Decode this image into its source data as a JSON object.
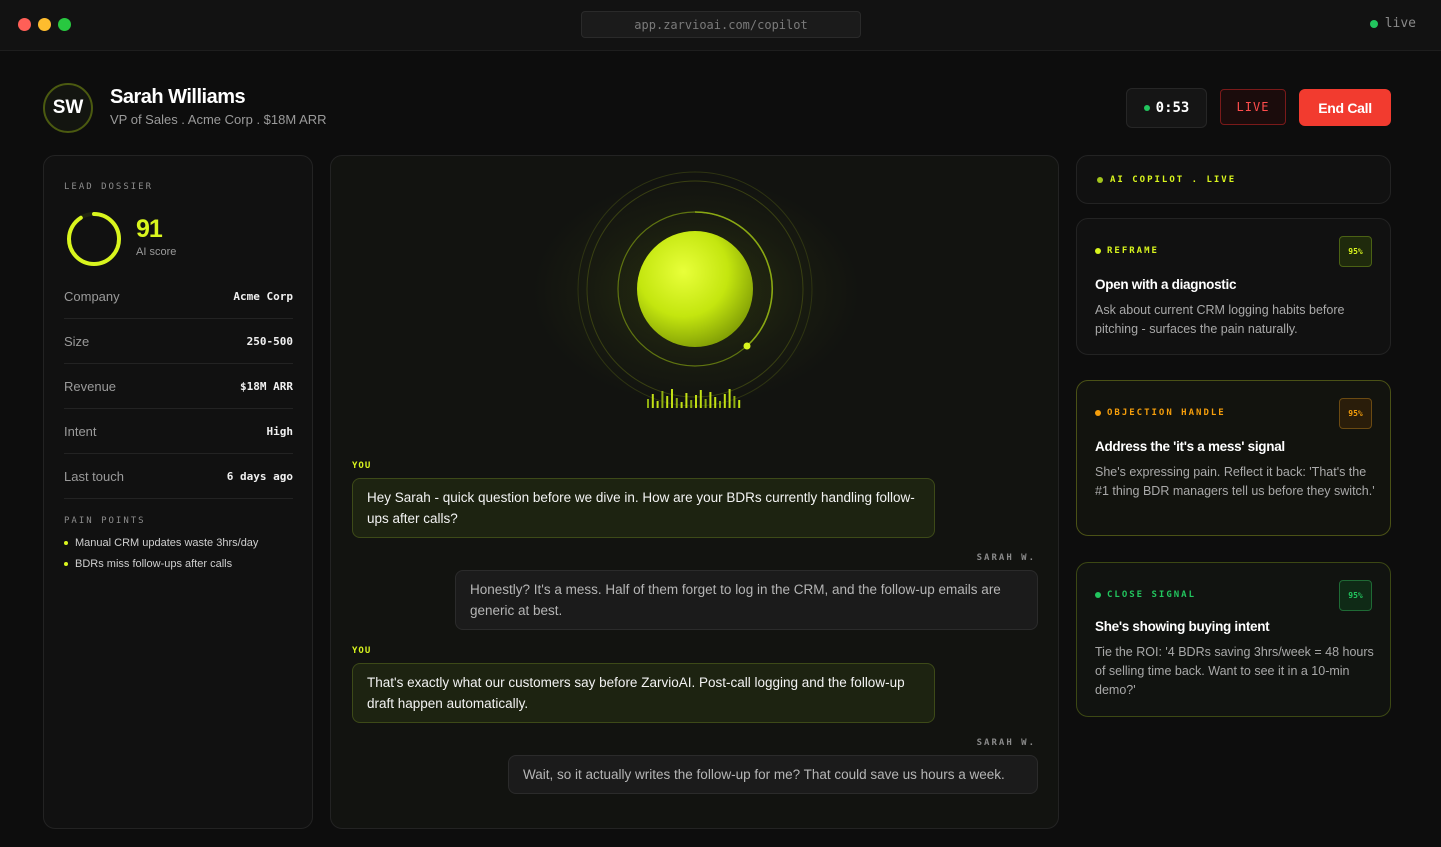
{
  "window": {
    "url": "app.zarvioai.com/copilot",
    "status": "live"
  },
  "header": {
    "initials": "SW",
    "name": "Sarah Williams",
    "subtitle": "VP of Sales . Acme Corp . $18M ARR",
    "timer": "0:53",
    "live_label": "LIVE",
    "end_call_label": "End Call"
  },
  "dossier": {
    "title": "LEAD DOSSIER",
    "score": "91",
    "score_fraction": 0.91,
    "score_label": "AI score",
    "rows": [
      {
        "label": "Company",
        "value": "Acme Corp"
      },
      {
        "label": "Size",
        "value": "250-500"
      },
      {
        "label": "Revenue",
        "value": "$18M ARR"
      },
      {
        "label": "Intent",
        "value": "High"
      },
      {
        "label": "Last touch",
        "value": "6 days ago"
      }
    ],
    "pain_title": "PAIN POINTS",
    "pain_points": [
      "Manual CRM updates waste 3hrs/day",
      "BDRs miss follow-ups after calls"
    ]
  },
  "chat": [
    {
      "speaker": "YOU",
      "text": "Hey Sarah - quick question before we dive in. How are your BDRs currently handling follow-ups after calls?"
    },
    {
      "speaker": "SARAH W.",
      "text": "Honestly? It's a mess. Half of them forget to log in the CRM, and the follow-up emails are generic at best."
    },
    {
      "speaker": "YOU",
      "text": "That's exactly what our customers say before ZarvioAI. Post-call logging and the follow-up draft happen automatically."
    },
    {
      "speaker": "SARAH W.",
      "text": "Wait, so it actually writes the follow-up for me? That could save us hours a week."
    }
  ],
  "copilot": {
    "header": "AI COPILOT . LIVE",
    "cards": [
      {
        "tag": "REFRAME",
        "confidence": "95%",
        "title": "Open with a diagnostic",
        "body": "Ask about current CRM logging habits before pitching - surfaces the pain naturally.",
        "color": "#d9f51e"
      },
      {
        "tag": "OBJECTION HANDLE",
        "confidence": "95%",
        "title": "Address the 'it's a mess' signal",
        "body": "She's expressing pain. Reflect it back: 'That's the #1 thing BDR managers tell us before they switch.'",
        "color": "#f59e0b"
      },
      {
        "tag": "CLOSE SIGNAL",
        "confidence": "95%",
        "title": "She's showing buying intent",
        "body": "Tie the ROI: '4 BDRs saving 3hrs/week = 48 hours of selling time back. Want to see it in a 10-min demo?'",
        "color": "#22c55e"
      }
    ]
  },
  "colors": {
    "accent": "#d9f51e",
    "danger": "#f23b2f",
    "success": "#22c55e",
    "warning": "#f59e0b"
  }
}
